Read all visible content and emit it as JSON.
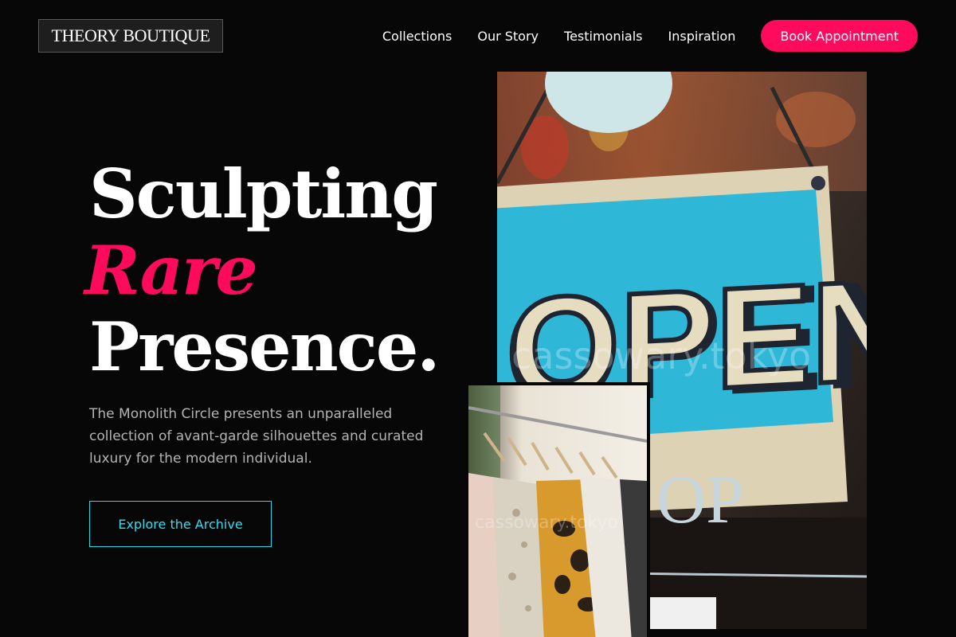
{
  "header": {
    "logo": "THEORY BOUTIQUE",
    "nav": [
      "Collections",
      "Our Story",
      "Testimonials",
      "Inspiration"
    ],
    "cta": "Book Appointment"
  },
  "hero": {
    "headline": [
      "Sculpting",
      "Rare",
      "Presence."
    ],
    "description": "The Monolith Circle presents an unparalleled collection of avant-garde silhouettes and curated luxury for the modern individual.",
    "button": "Explore the Archive"
  },
  "images": {
    "sign_word": "OPEN",
    "sign_lower": "OP",
    "watermark": "cassowary.tokyo"
  },
  "colors": {
    "accent": "#ff0a5c",
    "outline_accent": "#2fd5ea",
    "background": "#070707"
  }
}
